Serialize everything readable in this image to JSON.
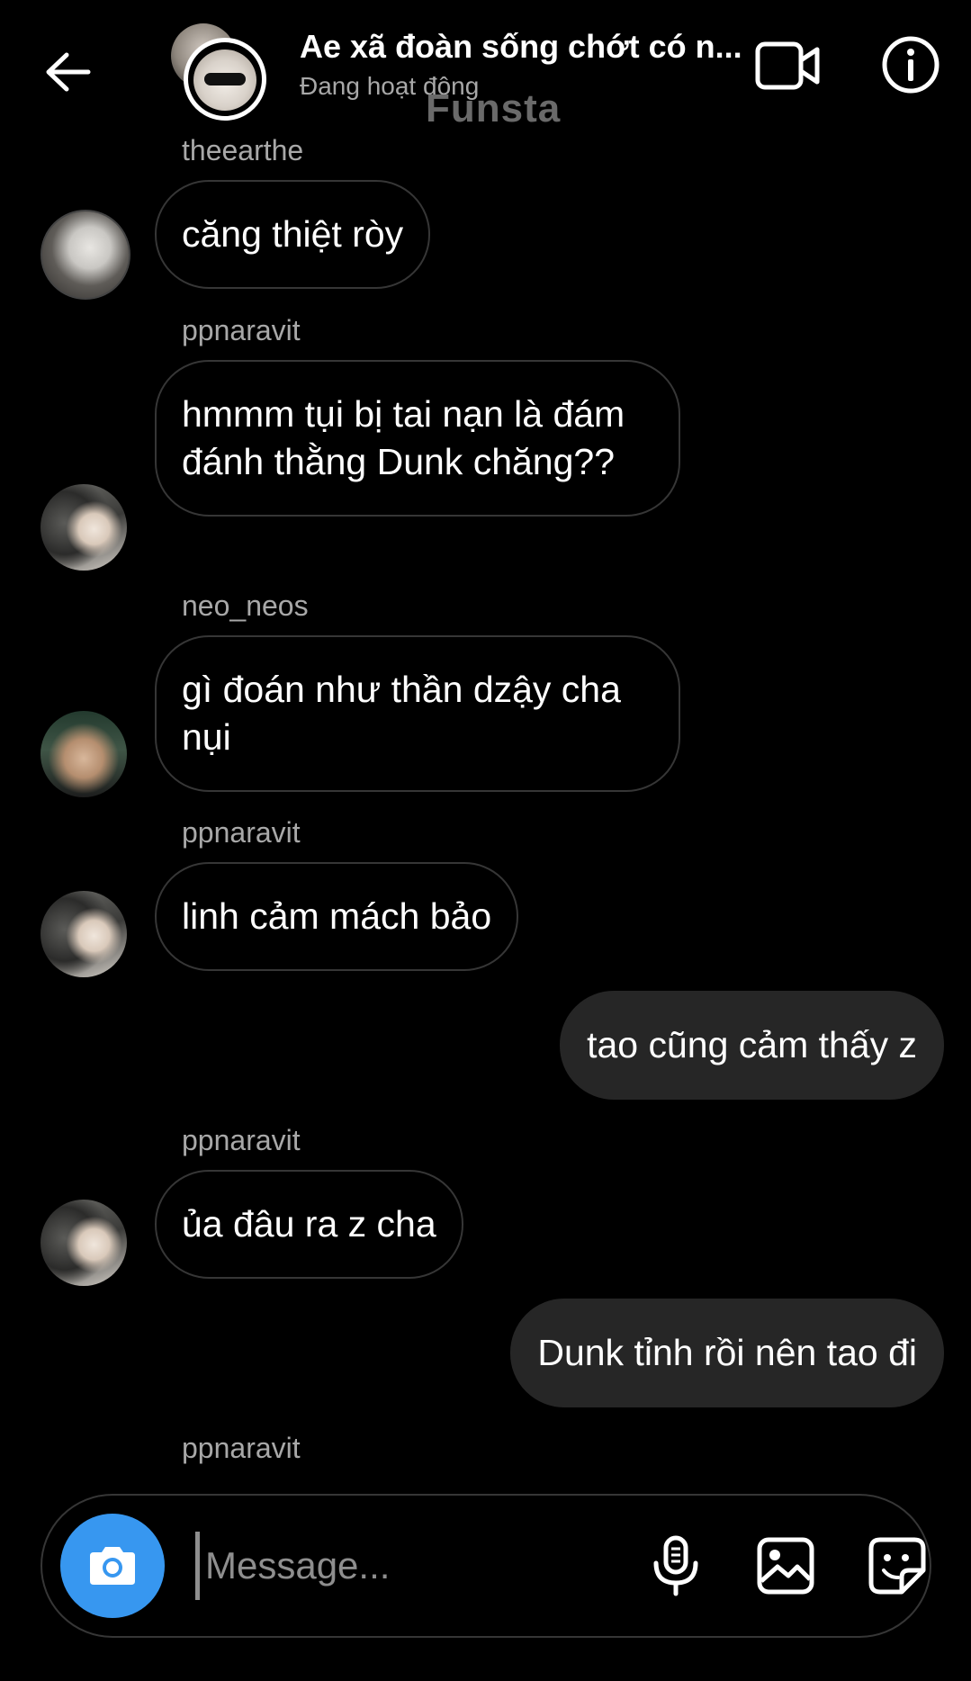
{
  "header": {
    "title": "Ae xã đoàn sống chớt có n...",
    "status": "Đang hoạt động",
    "watermark": "Funsta",
    "back_icon": "arrow-left-icon",
    "video_icon": "video-camera-icon",
    "info_icon": "info-icon"
  },
  "messages": [
    {
      "username": "theearthe",
      "text": "căng thiệt ròy",
      "direction": "incoming",
      "avatar": "theearthe"
    },
    {
      "username": "ppnaravit",
      "text": "hmmm tụi bị tai nạn là đám đánh thằng Dunk chăng??",
      "direction": "incoming",
      "avatar": "ppnaravit"
    },
    {
      "username": "neo_neos",
      "text": "gì đoán như thần dzậy cha nụi",
      "direction": "incoming",
      "avatar": "neo_neos"
    },
    {
      "username": "ppnaravit",
      "text": "linh cảm mách bảo",
      "direction": "incoming",
      "avatar": "ppnaravit"
    },
    {
      "username": "",
      "text": "tao cũng cảm thấy z",
      "direction": "outgoing"
    },
    {
      "username": "ppnaravit",
      "text": "ủa đâu ra z cha",
      "direction": "incoming",
      "avatar": "ppnaravit"
    },
    {
      "username": "",
      "text": "Dunk tỉnh rồi nên tao đi",
      "direction": "outgoing"
    }
  ],
  "trailing_username": "ppnaravit",
  "composer": {
    "placeholder": "Message...",
    "camera_icon": "camera-icon",
    "mic_icon": "microphone-icon",
    "gallery_icon": "image-icon",
    "sticker_icon": "sticker-icon"
  },
  "colors": {
    "background": "#000000",
    "camera_button": "#3797f0",
    "outgoing_bubble": "#262626",
    "secondary_text": "#a8a8a8"
  }
}
